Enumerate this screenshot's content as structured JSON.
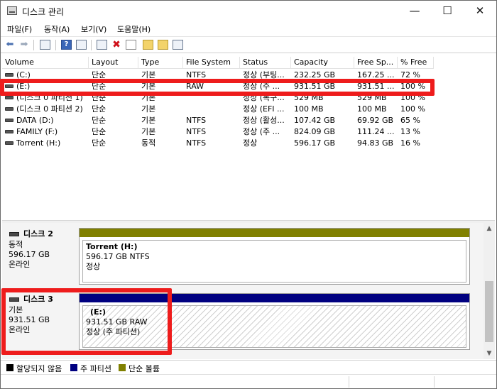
{
  "window": {
    "title": "디스크 관리",
    "controls": {
      "minimize": "—",
      "maximize": "☐",
      "close": "✕"
    }
  },
  "menu": [
    "파일(F)",
    "동작(A)",
    "보기(V)",
    "도움말(H)"
  ],
  "toolbar": {
    "icons": [
      "back-arrow-icon",
      "forward-arrow-icon",
      "console-tree-icon",
      "help-icon",
      "properties-icon",
      "connect-icon",
      "delete-icon",
      "check-icon",
      "export-icon",
      "search-icon",
      "settings-icon"
    ],
    "delete_glyph": "✖",
    "back_glyph": "⬅",
    "forward_glyph": "➡",
    "help_glyph": "?"
  },
  "volume_table": {
    "columns": [
      "Volume",
      "Layout",
      "Type",
      "File System",
      "Status",
      "Capacity",
      "Free Sp...",
      "% Free"
    ],
    "rows": [
      [
        "(C:)",
        "단순",
        "기본",
        "NTFS",
        "정상 (부팅...",
        "232.25 GB",
        "167.25 ...",
        "72 %"
      ],
      [
        "(E:)",
        "단순",
        "기본",
        "RAW",
        "정상 (주 ...",
        "931.51 GB",
        "931.51 ...",
        "100 %"
      ],
      [
        "(디스크 0 파티션 1)",
        "단순",
        "기본",
        "",
        "정상 (복구...",
        "529 MB",
        "529 MB",
        "100 %"
      ],
      [
        "(디스크 0 파티션 2)",
        "단순",
        "기본",
        "",
        "정상 (EFI ...",
        "100 MB",
        "100 MB",
        "100 %"
      ],
      [
        "DATA (D:)",
        "단순",
        "기본",
        "NTFS",
        "정상 (활성...",
        "107.42 GB",
        "69.92 GB",
        "65 %"
      ],
      [
        "FAMILY (F:)",
        "단순",
        "기본",
        "NTFS",
        "정상 (주 ...",
        "824.09 GB",
        "111.24 ...",
        "13 %"
      ],
      [
        "Torrent (H:)",
        "단순",
        "동적",
        "NTFS",
        "정상",
        "596.17 GB",
        "94.83 GB",
        "16 %"
      ]
    ]
  },
  "disks": [
    {
      "name": "디스크 2",
      "type": "동적",
      "size": "596.17 GB",
      "state": "온라인",
      "bar_color": "#808000",
      "partition": {
        "title": "Torrent  (H:)",
        "detail": "596.17 GB NTFS",
        "status": "정상"
      }
    },
    {
      "name": "디스크 3",
      "type": "기본",
      "size": "931.51 GB",
      "state": "온라인",
      "bar_color": "#000080",
      "partition": {
        "title": "(E:)",
        "detail": "931.51 GB RAW",
        "status": "정상 (주 파티션)"
      }
    }
  ],
  "legend": [
    {
      "label": "할당되지 않음",
      "color": "#000000"
    },
    {
      "label": "주 파티션",
      "color": "#000080"
    },
    {
      "label": "단순 볼륨",
      "color": "#808000"
    }
  ],
  "scrollbar": {
    "up": "▲",
    "down": "▼"
  },
  "highlight_color": "#ee1c1c"
}
